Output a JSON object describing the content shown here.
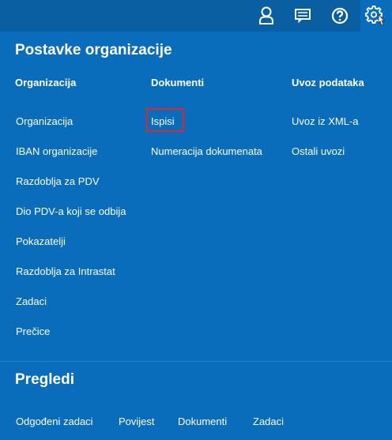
{
  "topbar": {
    "icons": [
      "user-icon",
      "messages-icon",
      "help-icon",
      "settings-icon"
    ]
  },
  "settings": {
    "title": "Postavke organizacije",
    "columns": [
      {
        "heading": "Organizacija",
        "items": [
          "Organizacija",
          "IBAN organizacije",
          "Razdoblja za PDV",
          "Dio PDV-a koji se odbija",
          "Pokazatelji",
          "Razdoblja za Intrastat",
          "Zadaci",
          "Prečice"
        ]
      },
      {
        "heading": "Dokumenti",
        "items": [
          "Ispisi",
          "Numeracija dokumenata"
        ]
      },
      {
        "heading": "Uvoz podataka",
        "items": [
          "Uvoz iz XML-a",
          "Ostali uvozi"
        ]
      }
    ]
  },
  "overviews": {
    "title": "Pregledi",
    "items": [
      "Odgođeni zadaci",
      "Povijest",
      "Dokumenti",
      "Zadaci"
    ]
  },
  "colors": {
    "panel": "#0a6dbb",
    "topbar": "#0a5ea2",
    "highlight": "#e0262c"
  }
}
